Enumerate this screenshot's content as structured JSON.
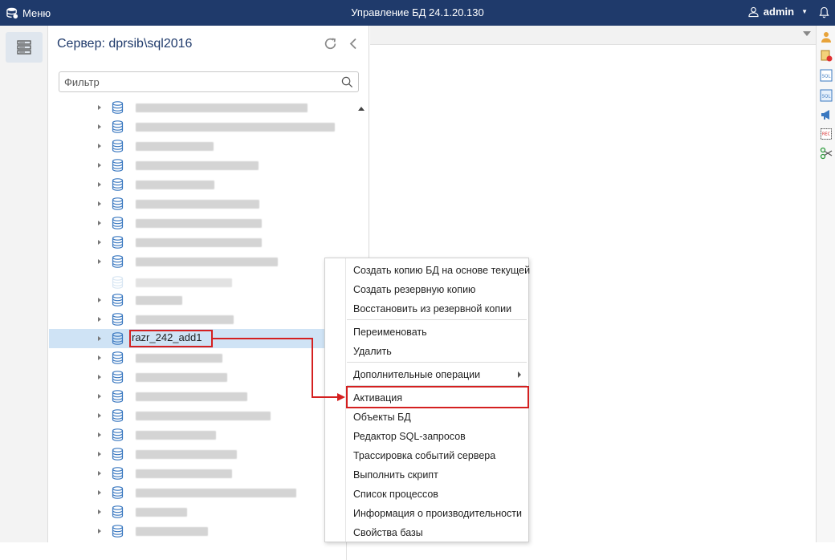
{
  "header": {
    "menu_label": "Меню",
    "title": "Управление БД 24.1.20.130",
    "user_name": "admin",
    "bg_color": "#1f3a6b"
  },
  "left_panel": {
    "title": "Сервер: dprsib\\sql2016",
    "filter": {
      "placeholder": "Фильтр",
      "value": ""
    }
  },
  "tree": {
    "selected_label": "razr_242_add1"
  },
  "icons": {
    "rail": "server-list-icon",
    "refresh": "refresh-icon",
    "collapse": "chevron-left-icon",
    "search": "search-icon",
    "database": "database-icon",
    "user": "user-icon",
    "notifications": "bell-icon"
  },
  "context_menu": {
    "items": [
      "Создать копию БД на основе текущей",
      "Создать резервную копию",
      "Восстановить из резервной копии",
      "Переименовать",
      "Удалить",
      "Дополнительные операции",
      "Активация",
      "Объекты БД",
      "Редактор SQL-запросов",
      "Трассировка событий сервера",
      "Выполнить скрипт",
      "Список процессов",
      "Информация о производительности",
      "Свойства базы"
    ]
  },
  "annotation_color": "#d42020"
}
